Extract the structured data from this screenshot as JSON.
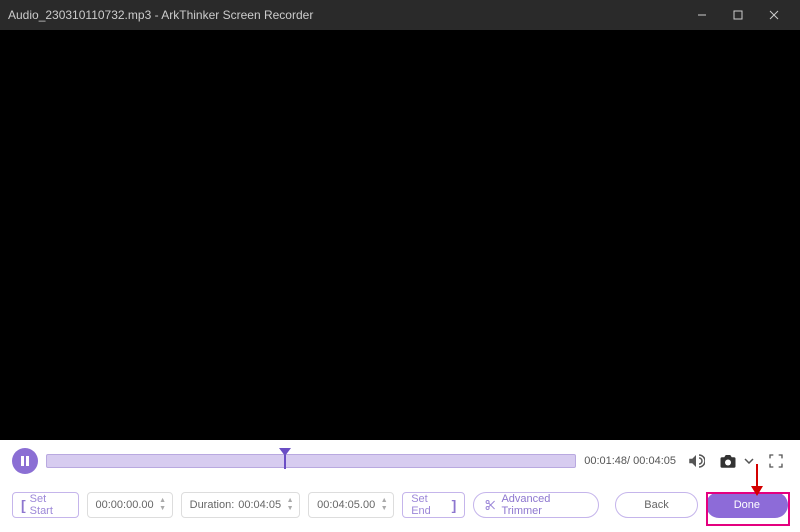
{
  "titlebar": {
    "filename": "Audio_230310110732.mp3",
    "separator": " - ",
    "app_name": "ArkThinker Screen Recorder"
  },
  "playback": {
    "current_time": "00:01:48",
    "total_time": "00:04:05"
  },
  "trim": {
    "set_start_label": "Set Start",
    "start_time": "00:00:00.00",
    "duration_label": "Duration:",
    "duration_value": "00:04:05",
    "end_time": "00:04:05.00",
    "set_end_label": "Set End",
    "advanced_label": "Advanced Trimmer"
  },
  "actions": {
    "back_label": "Back",
    "done_label": "Done"
  },
  "progress_percent": 44
}
